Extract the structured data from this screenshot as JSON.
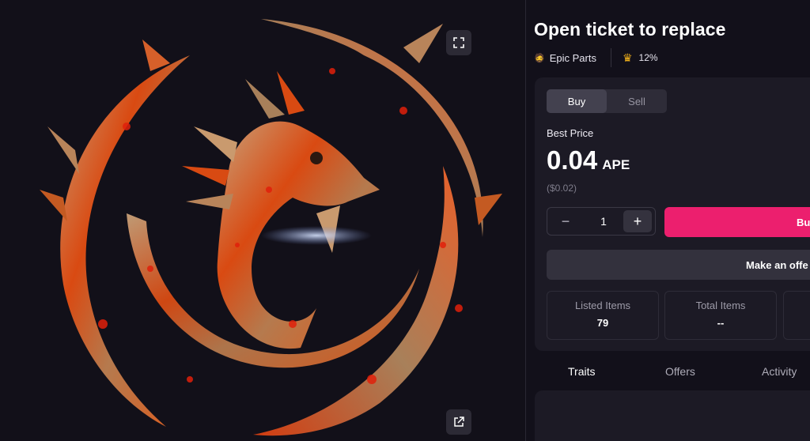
{
  "item": {
    "title": "Open ticket to replace",
    "collection_icon": "person-emoji-icon",
    "collection_name": "Epic Parts",
    "rarity_icon": "crown-icon",
    "rarity_percent": "12%"
  },
  "trade": {
    "tabs": [
      "Buy",
      "Sell"
    ],
    "active_tab": "Buy",
    "best_price_label": "Best Price",
    "price_value": "0.04",
    "price_currency": "APE",
    "price_usd": "($0.02)",
    "quantity": "1",
    "minus_label": "−",
    "plus_label": "+",
    "buy_button_label": "Bu",
    "offer_button_label": "Make an offe"
  },
  "stats": [
    {
      "label": "Listed Items",
      "value": "79"
    },
    {
      "label": "Total Items",
      "value": "--"
    }
  ],
  "detail_tabs": [
    "Traits",
    "Offers",
    "Activity"
  ],
  "active_detail_tab": "Traits",
  "colors": {
    "background": "#12101a",
    "card": "#1c1a25",
    "accent": "#ec1f6e",
    "crown": "#f3b21a"
  }
}
